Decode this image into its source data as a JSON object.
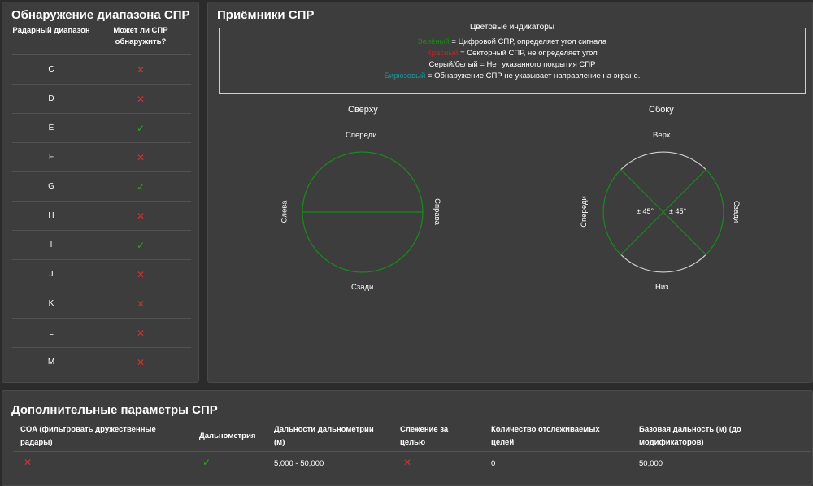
{
  "left_panel": {
    "title": "Обнаружение диапазона СПР",
    "col_band": "Радарный диапазон",
    "col_detect": "Может ли СПР обнаружить?",
    "rows": [
      {
        "band": "C",
        "detect": "✕",
        "ok": false
      },
      {
        "band": "D",
        "detect": "✕",
        "ok": false
      },
      {
        "band": "E",
        "detect": "✓",
        "ok": true
      },
      {
        "band": "F",
        "detect": "✕",
        "ok": false
      },
      {
        "band": "G",
        "detect": "✓",
        "ok": true
      },
      {
        "band": "H",
        "detect": "✕",
        "ok": false
      },
      {
        "band": "I",
        "detect": "✓",
        "ok": true
      },
      {
        "band": "J",
        "detect": "✕",
        "ok": false
      },
      {
        "band": "K",
        "detect": "✕",
        "ok": false
      },
      {
        "band": "L",
        "detect": "✕",
        "ok": false
      },
      {
        "band": "M",
        "detect": "✕",
        "ok": false
      }
    ]
  },
  "right_panel": {
    "title": "Приёмники СПР",
    "legend": {
      "title": "Цветовые индикаторы",
      "line1_word": "Зелёный",
      "line1_rest": " = Цифровой СПР, определяет угол сигнала",
      "line2_word": "Красный",
      "line2_rest": " = Секторный СПР, не определяет угол",
      "line3": "Серый/белый = Нет указанного покрытия СПР",
      "line4_word": "Бирюзовый",
      "line4_rest": " = Обнаружение СПР не указывает направление на экране."
    },
    "top_view": {
      "title": "Сверху",
      "front": "Спереди",
      "rear": "Сзади",
      "left": "Слева",
      "right": "Справа"
    },
    "side_view": {
      "title": "Сбоку",
      "top": "Верх",
      "bottom": "Низ",
      "front": "Спереди",
      "rear": "Сзади",
      "angle_left": "± 45°",
      "angle_right": "± 45°"
    }
  },
  "bottom_panel": {
    "title": "Дополнительные параметры СПР",
    "headers": {
      "coa": "COA (фильтровать дружественные радары)",
      "ranging": "Дальнометрия",
      "ranges": "Дальности дальнометрии (м)",
      "tracking": "Слежение за целью",
      "targets": "Количество отслеживаемых целей",
      "base_range": "Базовая дальность (м) (до модификаторов)"
    },
    "values": {
      "coa": "✕",
      "ranging": "✓",
      "ranges": "5,000 - 50,000",
      "tracking": "✕",
      "targets": "0",
      "base_range": "50,000"
    }
  },
  "colors": {
    "green": "#1a8a1a",
    "red": "#cc2222",
    "teal": "#1a9a9a",
    "panel": "#3d3d3d"
  }
}
